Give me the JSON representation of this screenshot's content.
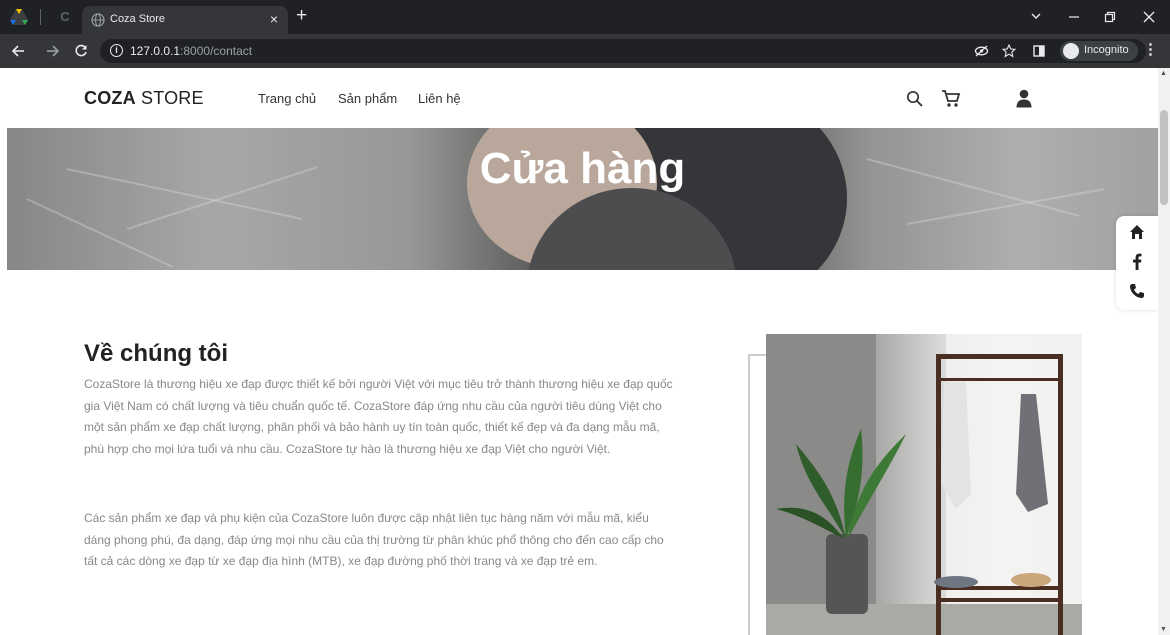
{
  "browser": {
    "tab_title": "Coza Store",
    "tab_close": "×",
    "new_tab": "+",
    "url_host": "127.0.0.1",
    "url_rest": ":8000/contact",
    "incognito_label": "Incognito",
    "icons": [
      "drive-icon",
      "back-icon",
      "forward-icon",
      "reload-icon",
      "info-icon",
      "eye-off-icon",
      "star-icon",
      "sidepanel-icon",
      "incognito-icon",
      "menu-icon",
      "minimize-icon",
      "restore-icon",
      "close-icon"
    ]
  },
  "header": {
    "logo_bold": "COZA",
    "logo_light": " STORE",
    "nav": [
      "Trang chủ",
      "Sản phẩm",
      "Liên hệ"
    ]
  },
  "hero": {
    "title": "Cửa hàng"
  },
  "social": {
    "icons": [
      "home-icon",
      "facebook-icon",
      "phone-icon"
    ]
  },
  "about": {
    "title": "Về chúng tôi",
    "p1": "CozaStore là thương hiệu xe đạp được thiết kế bởi người Việt với mục tiêu trở thành thương hiệu xe đạp quốc gia Việt Nam có chất lượng và tiêu chuẩn quốc tế. CozaStore đáp ứng nhu cầu của người tiêu dùng Việt cho một sản phẩm xe đạp chất lượng, phân phối và bảo hành uy tín toàn quốc, thiết kế đẹp và đa dạng mẫu mã, phù hợp cho mọi lứa tuổi và nhu cầu. CozaStore tự hào là thương hiệu xe đạp Việt cho người Việt.",
    "p2": "Các sản phẩm xe đạp và phụ kiện của CozaStore luôn được cập nhật liên tục hàng năm với mẫu mã, kiểu dáng phong phú, đa dạng, đáp ứng mọi nhu cầu của thị trường từ phân khúc phổ thông cho đến cao cấp cho tất cả các dòng xe đạp từ xe đạp địa hình (MTB), xe đạp đường phố thời trang và xe đạp trẻ em."
  },
  "colors": {
    "accent": "#222222",
    "body_text": "#888888",
    "browser_dark": "#202124"
  }
}
